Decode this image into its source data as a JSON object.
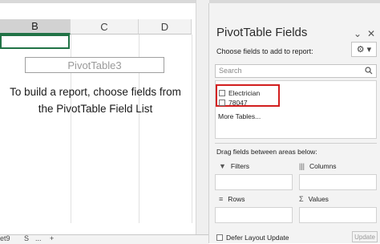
{
  "sheet": {
    "columns": [
      "B",
      "C",
      "D"
    ],
    "pivot_name": "PivotTable3",
    "pivot_message": "To build a report, choose fields from the PivotTable Field List",
    "tabs": {
      "left": "et9",
      "sep": "S",
      "more": "...",
      "add": "+"
    }
  },
  "pane": {
    "title": "PivotTable Fields",
    "chevron": "⌄",
    "close": "✕",
    "choose_label": "Choose fields to add to report:",
    "gear": "⚙ ▾",
    "search_placeholder": "Search",
    "fields": [
      "Electrician",
      "78047"
    ],
    "more_tables": "More Tables...",
    "drag_label": "Drag fields between areas below:",
    "areas": {
      "filters": "Filters",
      "columns": "Columns",
      "rows": "Rows",
      "values": "Values"
    },
    "defer_label": "Defer Layout Update",
    "update_label": "Update"
  },
  "colors": {
    "accent": "#217346",
    "highlight": "#d21e1e"
  }
}
